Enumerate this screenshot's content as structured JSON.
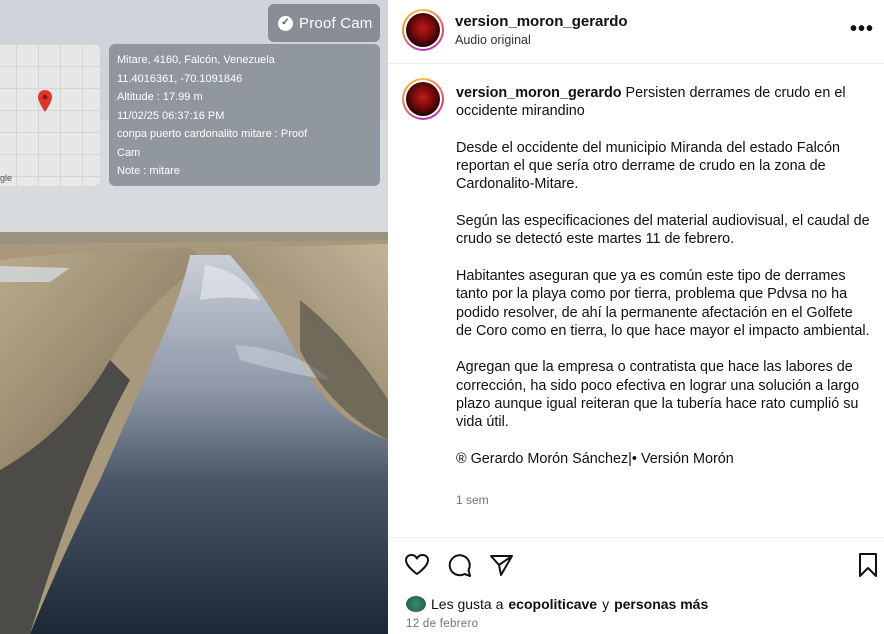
{
  "overlay": {
    "proof_cam_label": "Proof Cam",
    "google_label": "gle",
    "geo_lines": [
      "Mitare, 4160, Falcón, Venezuela",
      "11.4016361, -70.1091846",
      "Altitude : 17.99 m",
      "11/02/25 06:37:16 PM",
      "conpa puerto cardonalito mitare : Proof",
      "Cam",
      "Note : mitare"
    ]
  },
  "header": {
    "username": "version_moron_gerardo",
    "audio": "Audio original",
    "more": "•••"
  },
  "caption": {
    "username": "version_moron_gerardo",
    "title": " Persisten derrames de crudo en el occidente mirandino",
    "paragraphs": [
      "Desde el occidente del municipio Miranda del estado Falcón reportan el que sería otro derrame de crudo en la zona de Cardonalito-Mitare.",
      "Según las especificaciones del material audiovisual, el caudal de crudo se detectó este martes 11 de febrero.",
      "Habitantes aseguran que ya es común este tipo de derrames tanto por la playa como por tierra, problema que Pdvsa no ha podido resolver, de ahí la permanente afectación en el Golfete de Coro como en tierra, lo que hace mayor el impacto ambiental.",
      "Agregan que la empresa o contratista que hace las labores de corrección, ha sido poco efectiva en lograr una solución a largo plazo aunque igual reiteran que la tubería hace rato cumplió su vida útil.",
      "® Gerardo Morón Sánchez|• Versión Morón"
    ],
    "time": "1 sem"
  },
  "likes": {
    "prefix": "Les gusta a",
    "user": "ecopoliticave",
    "joiner": "y",
    "others": "personas más"
  },
  "date": "12 de febrero"
}
